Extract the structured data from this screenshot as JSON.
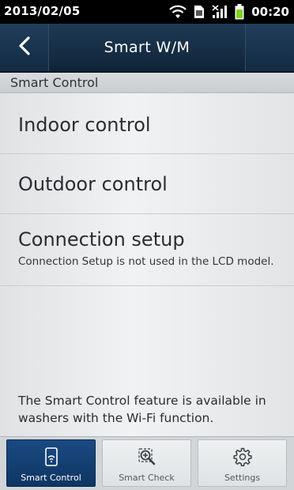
{
  "status_bar": {
    "date": "2013/02/05",
    "time": "00:20",
    "icons": [
      "wifi-icon",
      "sim-icon",
      "signal-icon",
      "battery-icon"
    ]
  },
  "header": {
    "title": "Smart W/M",
    "back_icon": "chevron-left-icon"
  },
  "section": {
    "label": "Smart Control"
  },
  "menu": [
    {
      "label": "Indoor control"
    },
    {
      "label": "Outdoor control"
    },
    {
      "label": "Connection setup",
      "description": "Connection Setup is not used in the LCD model."
    }
  ],
  "footer_note": "The Smart Control feature is available in washers with the Wi-Fi function.",
  "tabs": [
    {
      "label": "Smart Control",
      "icon": "phone-wifi-icon",
      "active": true
    },
    {
      "label": "Smart Check",
      "icon": "magnifier-icon",
      "active": false
    },
    {
      "label": "Settings",
      "icon": "gear-icon",
      "active": false
    }
  ],
  "colors": {
    "title_bar": "#0f2438",
    "active_tab": "#1a4a82",
    "battery": "#7ed321"
  }
}
